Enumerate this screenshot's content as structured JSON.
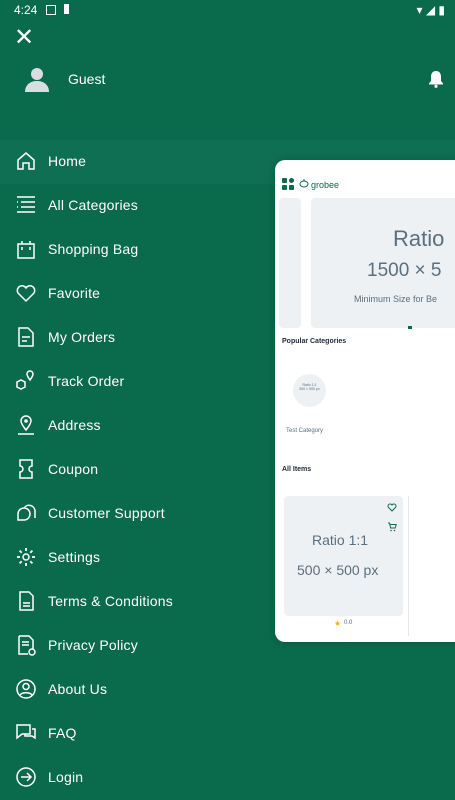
{
  "status_bar": {
    "time": "4:24"
  },
  "drawer": {
    "user": {
      "name": "Guest"
    },
    "menu": [
      {
        "label": "Home",
        "icon": "home-icon"
      },
      {
        "label": "All Categories",
        "icon": "categories-icon"
      },
      {
        "label": "Shopping Bag",
        "icon": "bag-icon"
      },
      {
        "label": "Favorite",
        "icon": "heart-icon"
      },
      {
        "label": "My Orders",
        "icon": "orders-icon"
      },
      {
        "label": "Track Order",
        "icon": "track-icon"
      },
      {
        "label": "Address",
        "icon": "location-icon"
      },
      {
        "label": "Coupon",
        "icon": "coupon-icon"
      },
      {
        "label": "Customer Support",
        "icon": "support-icon"
      },
      {
        "label": "Settings",
        "icon": "gear-icon"
      },
      {
        "label": "Terms & Conditions",
        "icon": "terms-icon"
      },
      {
        "label": "Privacy Policy",
        "icon": "privacy-icon"
      },
      {
        "label": "About Us",
        "icon": "about-icon"
      },
      {
        "label": "FAQ",
        "icon": "faq-icon"
      },
      {
        "label": "Login",
        "icon": "login-icon"
      }
    ]
  },
  "preview": {
    "logo": "grobee",
    "banner": {
      "line1": "Ratio",
      "line2": "1500 × 5",
      "line3": "Minimum Size for Be"
    },
    "popular_title": "Popular Categories",
    "category": {
      "placeholder_line1": "Ratio 1:1",
      "placeholder_line2": "500 × 500 px",
      "name": "Test Category"
    },
    "all_items_title": "All Items",
    "product": {
      "line1": "Ratio 1:1",
      "line2": "500 × 500 px",
      "rating": "0.0"
    }
  },
  "colors": {
    "primary": "#0a6a4c",
    "active_row": "#0e6f52",
    "star": "#f3b500"
  }
}
